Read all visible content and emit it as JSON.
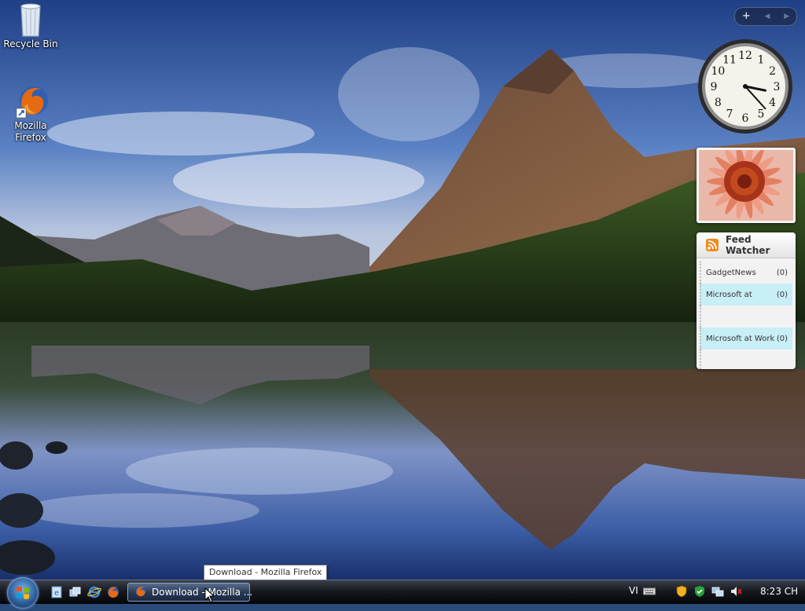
{
  "desktop": {
    "icons": [
      {
        "label": "Recycle Bin",
        "icon": "recycle-bin-icon"
      },
      {
        "label": "Mozilla Firefox",
        "icon": "firefox-icon"
      }
    ]
  },
  "gadgets": {
    "controls": {
      "add_label": "+",
      "prev_label": "◀",
      "next_label": "▶"
    },
    "clock": {
      "hour": 3,
      "minute": 23,
      "numbers": [
        "12",
        "1",
        "2",
        "3",
        "4",
        "5",
        "6",
        "7",
        "8",
        "9",
        "10",
        "11"
      ]
    },
    "slideshow": {
      "icon": "flower-photo"
    },
    "feed_watcher": {
      "title": "Feed Watcher",
      "items": [
        {
          "name": "GadgetNews",
          "count": "(0)",
          "highlight": false
        },
        {
          "name": "Microsoft at",
          "count": "(0)",
          "highlight": true
        },
        {
          "name": "",
          "count": "",
          "highlight": false
        },
        {
          "name": "Microsoft at Work",
          "count": "(0)",
          "highlight": true
        },
        {
          "name": "",
          "count": "",
          "highlight": false
        }
      ]
    }
  },
  "tooltip": {
    "text": "Download - Mozilla Firefox"
  },
  "taskbar": {
    "quick_launch": [
      "ie-settings-icon",
      "switch-windows-icon",
      "internet-explorer-icon",
      "firefox-icon"
    ],
    "tasks": [
      {
        "title": "Download - Mozilla ...",
        "icon": "firefox-icon"
      }
    ],
    "language": "VI",
    "tray_icons": [
      "security-shield-icon",
      "security-center-icon",
      "network-icon",
      "volume-muted-icon"
    ],
    "clock": "8:23 CH"
  },
  "colors": {
    "taskbar": "#16191f",
    "feed_highlight": "#c8eef6",
    "rss": "#f08a1e"
  }
}
